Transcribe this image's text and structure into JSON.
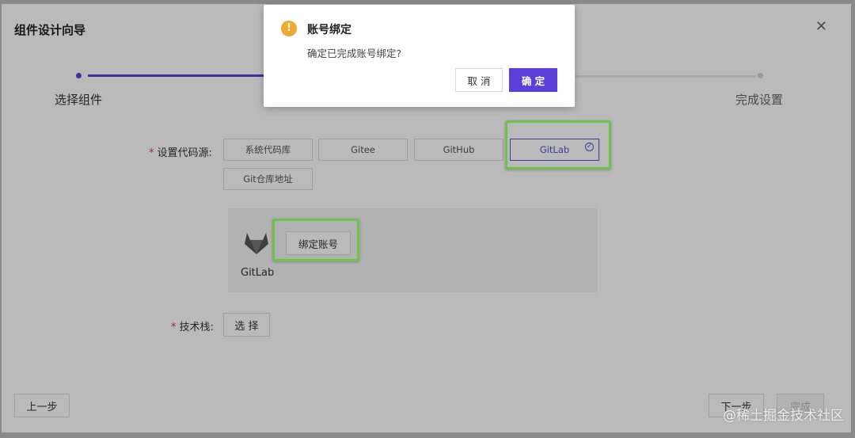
{
  "wizard": {
    "title": "组件设计向导",
    "steps": [
      "选择组件",
      "完成设置"
    ]
  },
  "form": {
    "source_label": "设置代码源:",
    "source_options": [
      "系统代码库",
      "Gitee",
      "GitHub",
      "GitLab",
      "Git仓库地址"
    ],
    "selected_source": "GitLab",
    "gitlab_caption": "GitLab",
    "bind_button": "绑定账号",
    "tech_label": "技术栈:",
    "tech_button": "选 择"
  },
  "footer": {
    "prev": "上一步",
    "next": "下一步",
    "finish": "完成"
  },
  "dialog": {
    "icon": "warning-icon",
    "title": "账号绑定",
    "message": "确定已完成账号绑定?",
    "cancel": "取 消",
    "ok": "确 定"
  },
  "watermark": "@稀土掘金技术社区",
  "colors": {
    "accent": "#5b3fd9",
    "highlight": "#6cc24a",
    "warning": "#f0a92e",
    "required": "#e53935"
  }
}
